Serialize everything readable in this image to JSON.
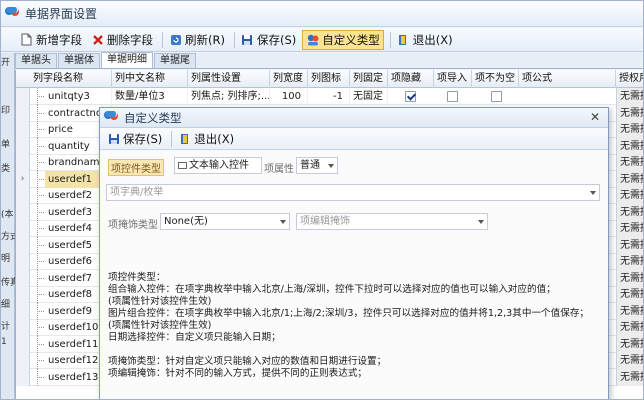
{
  "window": {
    "title": "单据界面设置"
  },
  "toolbar": {
    "add": "新增字段",
    "delete": "删除字段",
    "refresh": "刷新(R)",
    "save": "保存(S)",
    "custom_type": "自定义类型",
    "exit": "退出(X)"
  },
  "left_strip": [
    "开",
    "印",
    "单",
    "类",
    "(本",
    "方式",
    "明",
    "传真",
    "细",
    "计",
    "1"
  ],
  "tabs": [
    "单据头",
    "单据体",
    "单据明细",
    "单据尾"
  ],
  "grid": {
    "columns": [
      "列字段名称",
      "列中文名称",
      "列属性设置",
      "列宽度",
      "列图标",
      "列固定",
      "项隐藏",
      "项导入",
      "项不为空",
      "项公式",
      "授权用"
    ],
    "rows": [
      {
        "field": "unitqty3",
        "cn": "数量/单位3",
        "attr": "列焦点; 列排序;...",
        "width": "100",
        "icon": "-1",
        "fixed": "无固定",
        "hidden": true,
        "imp": false,
        "notnull": false,
        "auth": "无需授"
      },
      {
        "field": "contractno",
        "auth": "无需授"
      },
      {
        "field": "price",
        "auth": "无需授"
      },
      {
        "field": "quantity",
        "auth": "无需授"
      },
      {
        "field": "brandname",
        "auth": "无需授"
      },
      {
        "field": "userdef1",
        "auth": "无需授"
      },
      {
        "field": "userdef2",
        "auth": "无需授"
      },
      {
        "field": "userdef3",
        "auth": "无需授"
      },
      {
        "field": "userdef4",
        "auth": "无需授"
      },
      {
        "field": "userdef5",
        "auth": "无需授"
      },
      {
        "field": "userdef6",
        "auth": "无需授"
      },
      {
        "field": "userdef7",
        "auth": "无需授"
      },
      {
        "field": "userdef8",
        "auth": "无需授"
      },
      {
        "field": "userdef9",
        "auth": "无需授"
      },
      {
        "field": "userdef10",
        "auth": "无需授"
      },
      {
        "field": "userdef11",
        "auth": "无需授"
      },
      {
        "field": "userdef12",
        "auth": "无需授"
      },
      {
        "field": "userdef13",
        "auth": "无需授"
      }
    ],
    "selected_row": 5
  },
  "dialog": {
    "title": "自定义类型",
    "save": "保存(S)",
    "exit": "退出(X)",
    "control_type_label": "项控件类型",
    "control_type_value": "文本输入控件",
    "item_attr_label": "项属性",
    "item_attr_value": "普通",
    "dict_placeholder": "项字典/枚举",
    "mask_type_label": "项掩饰类型",
    "mask_type_value": "None(无)",
    "mask_edit_placeholder": "项编辑掩饰",
    "help": [
      "项控件类型：",
      "组合输入控件：在项字典枚举中输入北京/上海/深圳，控件下拉时可以选择对应的值也可以输入对应的值；",
      "(项属性针对该控件生效)",
      "图片组合控件：在项字典枚举中输入北京/1;上海/2;深圳/3，控件只可以选择对应的值并将1,2,3其中一个值保存；",
      "(项属性针对该控件生效)",
      "日期选择控件：自定义项只能输入日期；",
      "",
      "项掩饰类型：针对自定义项只能输入对应的数值和日期进行设置；",
      "项编辑掩饰：针对不同的输入方式，提供不同的正则表达式；"
    ]
  },
  "colors": {
    "accent": "#fbe38f",
    "selected_row": "#f4e3a8",
    "dialog_border": "#7e9bc2"
  }
}
